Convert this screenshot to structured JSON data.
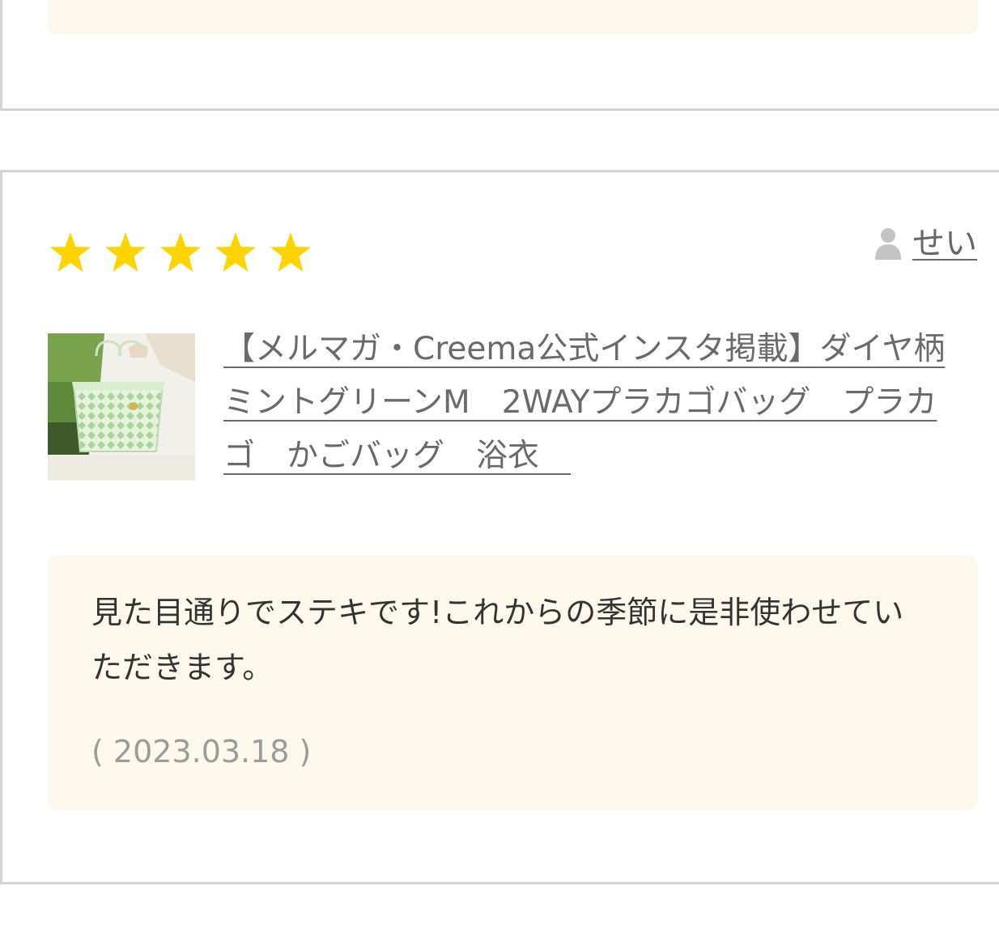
{
  "colors": {
    "star": "#fdd400",
    "comment_background": "#fcf8ec",
    "card_border": "#d3d3d3",
    "link_text": "#6a6a6a",
    "date_text": "#9b9b9b",
    "body_text": "#333333"
  },
  "review": {
    "rating": 5,
    "rating_max": 5,
    "reviewer": {
      "icon": "user-icon",
      "name": "せい"
    },
    "product": {
      "thumbnail_icon": "product-thumbnail",
      "title": "【メルマガ・Creema公式インスタ掲載】ダイヤ柄ミントグリーンM　2WAYプラカゴバッグ　プラカゴ　かごバッグ　浴衣　"
    },
    "comment": "見た目通りでステキです!これからの季節に是非使わせていただきます。",
    "date": "( 2023.03.18 )"
  }
}
